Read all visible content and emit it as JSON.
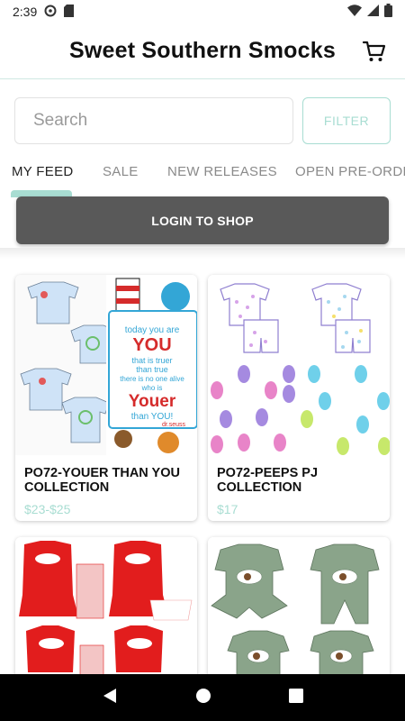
{
  "status": {
    "time": "2:39"
  },
  "header": {
    "title": "Sweet Southern Smocks"
  },
  "search": {
    "placeholder": "Search",
    "filter_label": "FILTER"
  },
  "tabs": [
    {
      "label": "MY FEED"
    },
    {
      "label": "SALE"
    },
    {
      "label": "NEW RELEASES"
    },
    {
      "label": "OPEN PRE-ORDE"
    }
  ],
  "login_label": "LOGIN TO SHOP",
  "colors": {
    "accent": "#a8ddd2",
    "login_bg": "#595959"
  },
  "products": [
    {
      "name": "PO72-YOUER THAN YOU COLLECTION",
      "price": "$23-$25",
      "image_text": [
        "today you are",
        "YOU",
        "that is truer",
        "than true",
        "there is no one alive",
        "who is",
        "Youer",
        "than YOU!",
        "dr.seuss"
      ]
    },
    {
      "name": "PO72-PEEPS PJ COLLECTION",
      "price": "$17"
    },
    {
      "name": "",
      "price": ""
    },
    {
      "name": "",
      "price": ""
    }
  ]
}
